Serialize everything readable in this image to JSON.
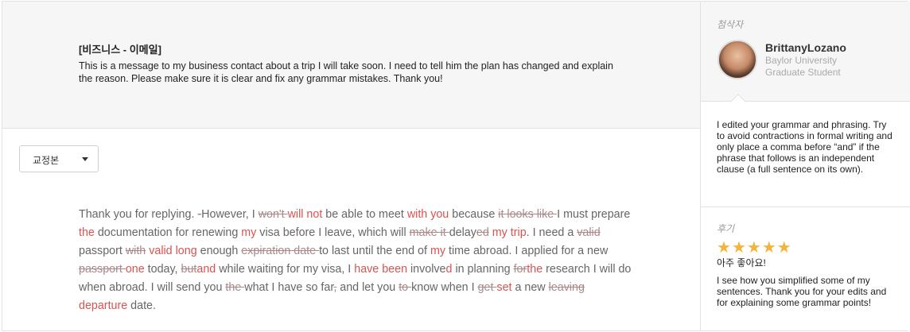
{
  "request": {
    "title": "[비즈니스 - 이메일]",
    "body": "This is a message to my business contact about a trip I will take soon. I need to tell him the plan has changed and explain the reason. Please make sure it is clear and fix any grammar mistakes. Thank you!"
  },
  "version_dropdown": {
    "selected": "교정본",
    "icon": "caret-down-icon"
  },
  "correction": {
    "segments": [
      {
        "t": "Thank you for replying. ",
        "k": "n"
      },
      {
        "t": "-",
        "k": "d"
      },
      {
        "t": "However, I ",
        "k": "n"
      },
      {
        "t": "won't ",
        "k": "d"
      },
      {
        "t": "will not",
        "k": "i"
      },
      {
        "t": " be able to meet ",
        "k": "n"
      },
      {
        "t": "with you",
        "k": "i"
      },
      {
        "t": " because ",
        "k": "n"
      },
      {
        "t": "it looks like ",
        "k": "d"
      },
      {
        "t": "I must prepare ",
        "k": "n"
      },
      {
        "t": "the",
        "k": "i"
      },
      {
        "t": " documentation for renewing ",
        "k": "n"
      },
      {
        "t": "my",
        "k": "i"
      },
      {
        "t": " visa before I leave, which will ",
        "k": "n"
      },
      {
        "t": "make it ",
        "k": "d"
      },
      {
        "t": "delay",
        "k": "n"
      },
      {
        "t": "ed",
        "k": "d"
      },
      {
        "t": " ",
        "k": "n"
      },
      {
        "t": "my trip",
        "k": "i"
      },
      {
        "t": ". I need a ",
        "k": "n"
      },
      {
        "t": "valid ",
        "k": "d"
      },
      {
        "t": "passport ",
        "k": "n"
      },
      {
        "t": "with",
        "k": "d"
      },
      {
        "t": " ",
        "k": "n"
      },
      {
        "t": "valid long",
        "k": "i"
      },
      {
        "t": " enough ",
        "k": "n"
      },
      {
        "t": "expiration date ",
        "k": "d"
      },
      {
        "t": "to last until the end of ",
        "k": "n"
      },
      {
        "t": "my",
        "k": "i"
      },
      {
        "t": " time abroad. I applied for a new ",
        "k": "n"
      },
      {
        "t": "passport ",
        "k": "d"
      },
      {
        "t": "one",
        "k": "i"
      },
      {
        "t": " today, ",
        "k": "n"
      },
      {
        "t": "but",
        "k": "d"
      },
      {
        "t": "and",
        "k": "i"
      },
      {
        "t": " while waiting for my visa, I ",
        "k": "n"
      },
      {
        "t": "have been",
        "k": "i"
      },
      {
        "t": " involve",
        "k": "n"
      },
      {
        "t": "d",
        "k": "i"
      },
      {
        "t": " in planning ",
        "k": "n"
      },
      {
        "t": "for",
        "k": "d"
      },
      {
        "t": "the",
        "k": "i"
      },
      {
        "t": " research I will do when abroad. I will send you ",
        "k": "n"
      },
      {
        "t": "the ",
        "k": "d"
      },
      {
        "t": "what I have so far",
        "k": "n"
      },
      {
        "t": ",",
        "k": "d"
      },
      {
        "t": " and let you ",
        "k": "n"
      },
      {
        "t": "to ",
        "k": "d"
      },
      {
        "t": "know when I ",
        "k": "n"
      },
      {
        "t": "get ",
        "k": "d"
      },
      {
        "t": "set",
        "k": "i"
      },
      {
        "t": " a new ",
        "k": "n"
      },
      {
        "t": "leaving ",
        "k": "d"
      },
      {
        "t": "departure",
        "k": "i"
      },
      {
        "t": " date.",
        "k": "n"
      }
    ]
  },
  "tutor": {
    "section_label": "첨삭자",
    "name": "BrittanyLozano",
    "school": "Baylor University",
    "level": "Graduate Student",
    "comment": "I edited your grammar and phrasing. Try to avoid contractions in formal writing and only place a comma before “and” if the phrase that follows is an independent clause (a full sentence on its own)."
  },
  "review": {
    "section_label": "후기",
    "rating": 5,
    "rating_max": 5,
    "star_color": "#f6b33c",
    "rating_text": "아주 좋아요!",
    "text": "I see how you simplified some of my sentences. Thank you for your edits and for explaining some grammar points!"
  },
  "colors": {
    "insertion": "#d9534f",
    "deletion": "#a88",
    "panel_bg": "#f6f6f6"
  }
}
